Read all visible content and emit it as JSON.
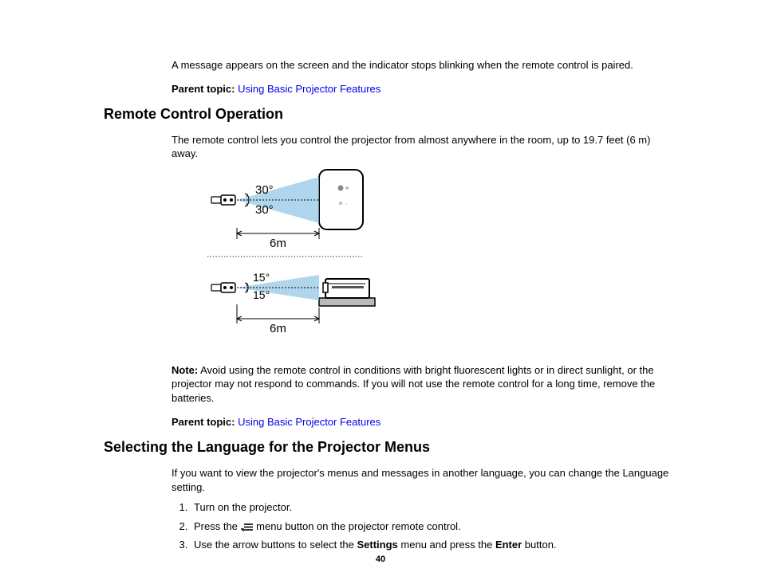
{
  "intro_para": "A message appears on the screen and the indicator stops blinking when the remote control is paired.",
  "parent_topic_label": "Parent topic:",
  "parent_topic_link": "Using Basic Projector Features",
  "heading1": "Remote Control Operation",
  "remote_para": "The remote control lets you control the projector from almost anywhere in the room, up to 19.7 feet (6 m) away.",
  "diagram": {
    "top_angle_upper": "30°",
    "top_angle_lower": "30°",
    "bottom_angle_upper": "15°",
    "bottom_angle_lower": "15°",
    "distance_label": "6m"
  },
  "note_label": "Note:",
  "note_text": "Avoid using the remote control in conditions with bright fluorescent lights or in direct sunlight, or the projector may not respond to commands. If you will not use the remote control for a long time, remove the batteries.",
  "heading2": "Selecting the Language for the Projector Menus",
  "lang_para": "If you want to view the projector's menus and messages in another language, you can change the Language setting.",
  "step1": "Turn on the projector.",
  "step2a": "Press the ",
  "step2b": " menu button on the projector remote control.",
  "step3a": "Use the arrow buttons to select the ",
  "step3_settings": "Settings",
  "step3b": " menu and press the ",
  "step3_enter": "Enter",
  "step3c": " button.",
  "page_number": "40"
}
